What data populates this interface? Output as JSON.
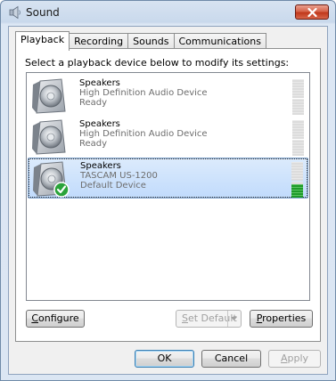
{
  "window": {
    "title": "Sound",
    "title_icon": "speaker-icon",
    "close_icon": "close-icon"
  },
  "tabs": [
    {
      "label": "Playback",
      "active": true
    },
    {
      "label": "Recording",
      "active": false
    },
    {
      "label": "Sounds",
      "active": false
    },
    {
      "label": "Communications",
      "active": false
    }
  ],
  "instruction": "Select a playback device below to modify its settings:",
  "devices": [
    {
      "name": "Speakers",
      "description": "High Definition Audio Device",
      "status": "Ready",
      "selected": false,
      "default": false,
      "icon": "speaker-icon",
      "meter_level": 0
    },
    {
      "name": "Speakers",
      "description": "High Definition Audio Device",
      "status": "Ready",
      "selected": false,
      "default": false,
      "icon": "speaker-icon",
      "meter_level": 0
    },
    {
      "name": "Speakers",
      "description": "TASCAM US-1200",
      "status": "Default Device",
      "selected": true,
      "default": true,
      "icon": "speaker-icon",
      "badge_icon": "green-check-icon",
      "meter_level": 0.35
    }
  ],
  "buttons": {
    "configure": {
      "prefix": "",
      "accel": "C",
      "rest": "onfigure"
    },
    "set_default": {
      "prefix": "",
      "accel": "S",
      "rest": "et Default",
      "enabled": false
    },
    "properties": {
      "prefix": "",
      "accel": "P",
      "rest": "roperties"
    },
    "ok": "OK",
    "cancel": "Cancel",
    "apply": {
      "prefix": "",
      "accel": "A",
      "rest": "pply",
      "enabled": false
    }
  },
  "colors": {
    "selection": "#c1dbfc",
    "meter_on": "#1e9a2a",
    "close_button": "#c0391c"
  }
}
